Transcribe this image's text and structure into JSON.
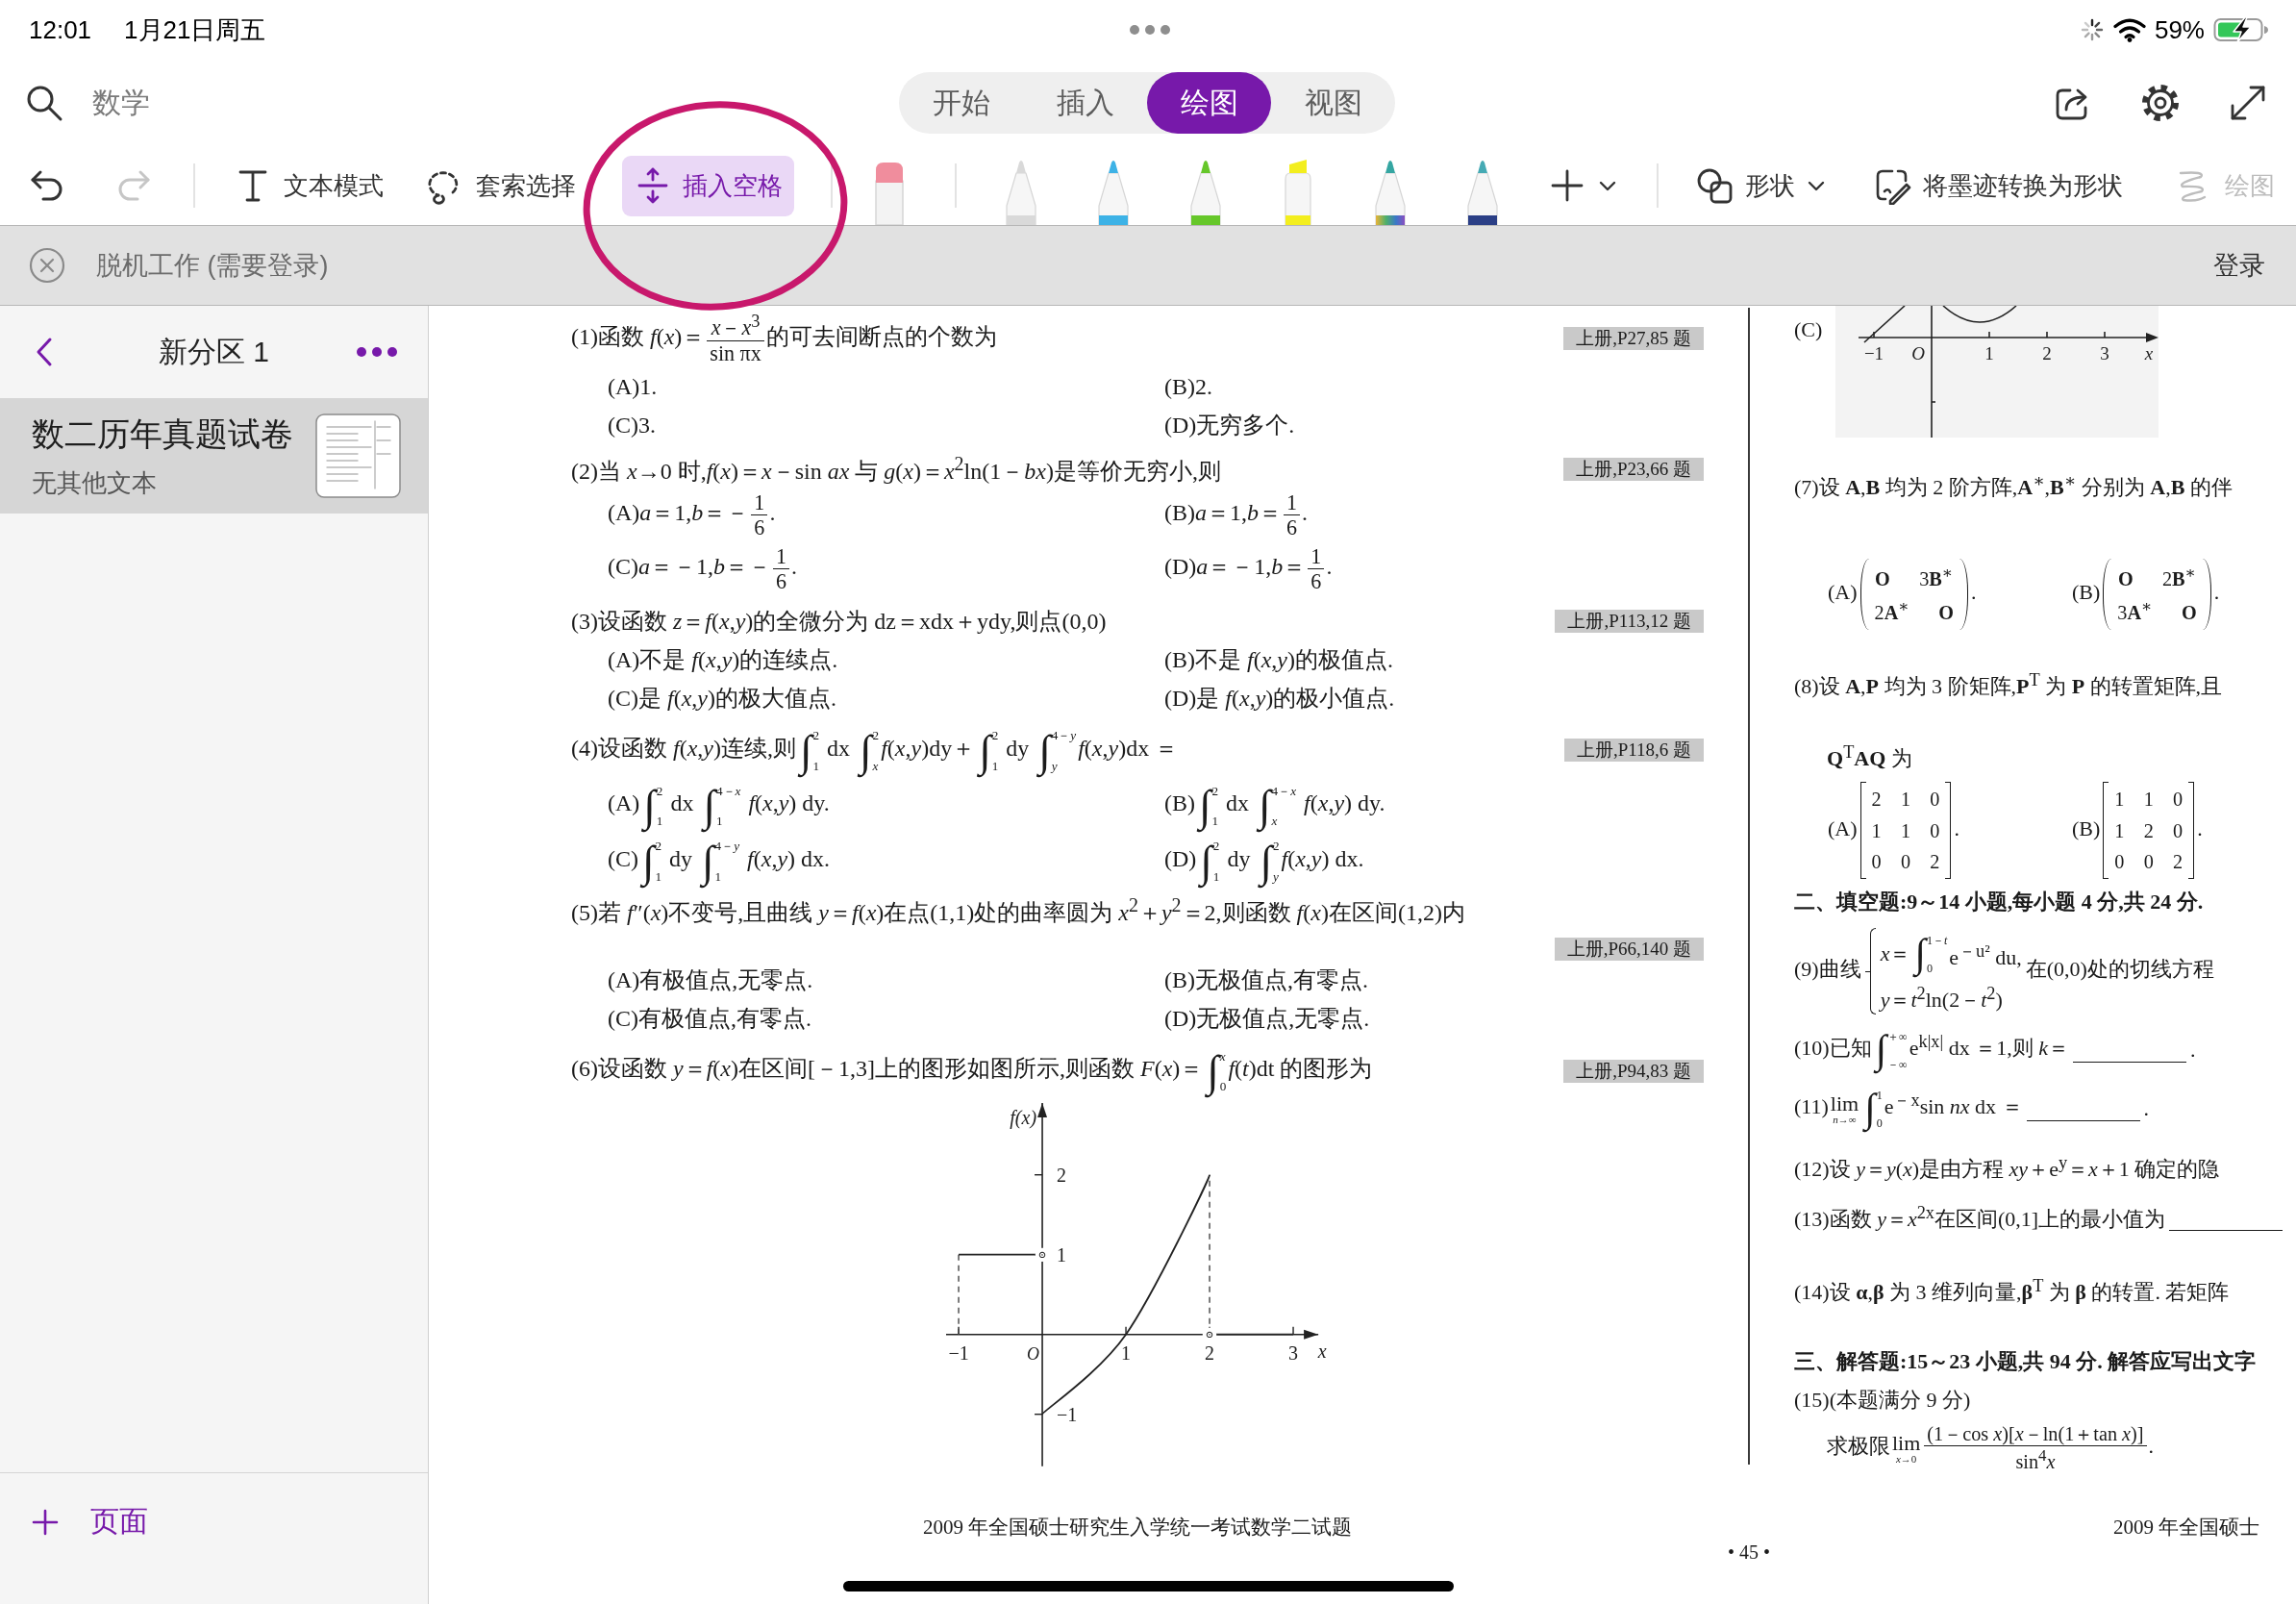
{
  "status_bar": {
    "time": "12:01",
    "date": "1月21日周五",
    "battery": "59%",
    "charging": true
  },
  "header": {
    "notebook": "数学",
    "tabs": [
      {
        "label": "开始",
        "selected": false
      },
      {
        "label": "插入",
        "selected": false
      },
      {
        "label": "绘图",
        "selected": true
      },
      {
        "label": "视图",
        "selected": false
      }
    ]
  },
  "toolbar": {
    "undo": {
      "disabled": false
    },
    "redo": {
      "disabled": true
    },
    "tools": [
      {
        "kind": "text",
        "label": "文本模式",
        "selected": false
      },
      {
        "kind": "lasso",
        "label": "套索选择",
        "selected": false
      },
      {
        "kind": "space",
        "label": "插入空格",
        "selected": true
      }
    ],
    "eraser": {
      "selected": false
    },
    "pens": [
      {
        "kind": "pen",
        "color": "#d9d9d9",
        "selected": false
      },
      {
        "kind": "pen",
        "color": "#3db2e6",
        "selected": false
      },
      {
        "kind": "pen",
        "color": "#66c72a",
        "selected": false
      },
      {
        "kind": "highlighter",
        "color": "#f3ee1e",
        "selected": false
      },
      {
        "kind": "rainbow",
        "color": "#35a6a2",
        "selected": false
      },
      {
        "kind": "cosmic",
        "color": "#45aab4",
        "selected": false
      }
    ],
    "shapes": {
      "label": "形状"
    },
    "ink_to_shape": {
      "label": "将墨迹转换为形状"
    },
    "ink_tool": {
      "label": "绘图"
    }
  },
  "notice": {
    "message": "脱机工作 (需要登录)",
    "action": "登录"
  },
  "sidebar": {
    "section": "新分区 1",
    "pages": [
      {
        "title": "数二历年真题试卷",
        "preview": "无其他文本",
        "selected": true
      }
    ],
    "add_page": "页面"
  },
  "document": {
    "left_column": {
      "questions": [
        {
          "lines": [
            [
              "(1)函数 *f*(*x*)＝",
              {
                "kind": "frac",
                "num": "*x*－*x*$^{3}$",
                "den": "sin πx"
              },
              "的可去间断点的个数为"
            ]
          ],
          "tag": "上册,P27,85 题",
          "options": [
            [
              "(A)1."
            ],
            [
              "(B)2."
            ],
            [
              "(C)3."
            ],
            [
              "(D)无穷多个."
            ]
          ]
        },
        {
          "lines": [
            [
              "(2)当 *x*→0 时,*f*(*x*)＝*x*－sin *ax* 与 *g*(*x*)＝*x*$^{2}$ln(1－*bx*)是等价无穷小,则"
            ]
          ],
          "tag": "上册,P23,66 题",
          "options": [
            [
              "(A)*a*＝1,*b*＝－",
              {
                "kind": "frac",
                "num": "1",
                "den": "6"
              },
              "."
            ],
            [
              "(B)*a*＝1,*b*＝",
              {
                "kind": "frac",
                "num": "1",
                "den": "6"
              },
              "."
            ],
            [
              "(C)*a*＝－1,*b*＝－",
              {
                "kind": "frac",
                "num": "1",
                "den": "6"
              },
              "."
            ],
            [
              "(D)*a*＝－1,*b*＝",
              {
                "kind": "frac",
                "num": "1",
                "den": "6"
              },
              "."
            ]
          ]
        },
        {
          "lines": [
            [
              "(3)设函数 *z*＝*f*(*x*,*y*)的全微分为 dz＝xdx＋ydy,则点(0,0)"
            ]
          ],
          "tag": "上册,P113,12 题",
          "options": [
            [
              "(A)不是 *f*(*x*,*y*)的连续点."
            ],
            [
              "(B)不是 *f*(*x*,*y*)的极值点."
            ],
            [
              "(C)是 *f*(*x*,*y*)的极大值点."
            ],
            [
              "(D)是 *f*(*x*,*y*)的极小值点."
            ]
          ]
        },
        {
          "lines": [
            [
              "(4)设函数 *f*(*x*,*y*)连续,则",
              {
                "kind": "int",
                "sign": "∫",
                "lower": "1",
                "upper": "2"
              },
              " dx ",
              {
                "kind": "int",
                "sign": "∫",
                "lower": "*x*",
                "upper": "2"
              },
              "*f*(*x*,*y*)dy＋",
              {
                "kind": "int",
                "sign": "∫",
                "lower": "1",
                "upper": "2"
              },
              " dy ",
              {
                "kind": "int",
                "sign": "∫",
                "lower": "*y*",
                "upper": "4－*y*"
              },
              "*f*(*x*,*y*)dx ＝"
            ]
          ],
          "tag": "上册,P118,6 题",
          "options": [
            [
              "(A)",
              {
                "kind": "int",
                "sign": "∫",
                "lower": "1",
                "upper": "2"
              },
              " dx ",
              {
                "kind": "int",
                "sign": "∫",
                "lower": "1",
                "upper": "4－*x*"
              },
              " *f*(*x*,*y*) dy."
            ],
            [
              "(B)",
              {
                "kind": "int",
                "sign": "∫",
                "lower": "1",
                "upper": "2"
              },
              " dx ",
              {
                "kind": "int",
                "sign": "∫",
                "lower": "*x*",
                "upper": "4－*x*"
              },
              " *f*(*x*,*y*) dy."
            ],
            [
              "(C)",
              {
                "kind": "int",
                "sign": "∫",
                "lower": "1",
                "upper": "2"
              },
              " dy ",
              {
                "kind": "int",
                "sign": "∫",
                "lower": "1",
                "upper": "4－*y*"
              },
              " *f*(*x*,*y*) dx."
            ],
            [
              "(D)",
              {
                "kind": "int",
                "sign": "∫",
                "lower": "1",
                "upper": "2"
              },
              " dy ",
              {
                "kind": "int",
                "sign": "∫",
                "lower": "*y*",
                "upper": "2"
              },
              "*f*(*x*,*y*) dx."
            ]
          ]
        },
        {
          "lines": [
            [
              "(5)若 *f*″(*x*)不变号,且曲线 *y*＝*f*(*x*)在点(1,1)处的曲率圆为 *x*$^{2}$＋*y*$^{2}$＝2,则函数 *f*(*x*)在区间(1,2)内"
            ]
          ],
          "tag": "上册,P66,140 题",
          "options": [
            [
              "(A)有极值点,无零点."
            ],
            [
              "(B)无极值点,有零点."
            ],
            [
              "(C)有极值点,有零点."
            ],
            [
              "(D)无极值点,无零点."
            ]
          ]
        },
        {
          "lines": [
            [
              "(6)设函数 *y*＝*f*(*x*)在区间[－1,3]上的图形如图所示,则函数 *F*(*x*)＝",
              {
                "kind": "int",
                "sign": "∫",
                "lower": "0",
                "upper": "*x*"
              },
              "*f*(*t*)dt 的图形为"
            ]
          ],
          "tag": "上册,P94,83 题",
          "chart_data": {
            "type": "line",
            "xlabel": "x",
            "ylabel": "f(x)",
            "x": [
              -1,
              0,
              1,
              2,
              3
            ],
            "series": [
              {
                "values": [
                  1,
                  1,
                  null,
                  null,
                  null
                ]
              },
              {
                "values": [
                  null,
                  -1,
                  0,
                  2,
                  null
                ]
              },
              {
                "values": [
                  null,
                  null,
                  null,
                  0,
                  0
                ]
              }
            ],
            "xlim": [
              -1.15,
              3.3
            ],
            "ylim": [
              -1.65,
              2.9
            ],
            "xticks": [
              {
                "value": -1,
                "label": "−1"
              },
              {
                "value": 0,
                "label": "O"
              },
              {
                "value": 1,
                "label": "1"
              },
              {
                "value": 2,
                "label": "2"
              },
              {
                "value": 3,
                "label": "3"
              }
            ],
            "yticks": [
              {
                "value": -1,
                "label": "−1"
              },
              {
                "value": 1,
                "label": "1"
              },
              {
                "value": 2,
                "label": "2"
              }
            ],
            "ref_lines": [
              {
                "axis": "x",
                "value": -1
              },
              {
                "axis": "x",
                "value": 2
              }
            ],
            "annotations": [
              {
                "x": 0,
                "y": 1,
                "text": "◦"
              },
              {
                "x": 2,
                "y": 0,
                "text": "◦"
              }
            ]
          }
        }
      ],
      "footer": "2009 年全国硕士研究生入学统一考试数学二试题"
    },
    "page_number": "• 45 •",
    "right_column": {
      "blocks": [
        {
          "kind": "figure",
          "label": "(C)",
          "tick_labels": [
            "−1",
            "O",
            "1",
            "2",
            "3",
            "x"
          ]
        },
        {
          "kind": "question",
          "lines": [
            [
              "(7)设 **A**,**B** 均为 2 阶方阵,**A**$^{∗}$,**B**$^{∗}$ 分别为 **A**,**B** 的伴"
            ]
          ],
          "options": [
            [
              "(A)",
              {
                "kind": "pmatrix",
                "lines": [
                  "**O**      3**B**$^{∗}$",
                  "2**A**$^{∗}$      **O**"
                ]
              },
              "."
            ],
            [
              "(B)",
              {
                "kind": "pmatrix",
                "lines": [
                  "**O**      2**B**$^{∗}$",
                  "3**A**$^{∗}$      **O**"
                ]
              },
              "."
            ]
          ]
        },
        {
          "kind": "question",
          "lines": [
            [
              "(8)设 **A**,**P** 均为 3 阶矩阵,**P**$^{T}$ 为 **P** 的转置矩阵,且"
            ],
            [
              "**Q**$^{T}$**AQ** 为"
            ]
          ],
          "options": [
            [
              "(A)",
              {
                "kind": "bmatrix",
                "lines": [
                  "2    1    0",
                  "1    1    0",
                  "0    0    2"
                ]
              },
              "."
            ],
            [
              "(B)",
              {
                "kind": "bmatrix",
                "lines": [
                  "1    1    0",
                  "1    2    0",
                  "0    0    2"
                ]
              },
              "."
            ]
          ]
        },
        {
          "kind": "heading",
          "text": "二、填空题:9～14 小题,每小题 4 分,共 24 分."
        },
        {
          "kind": "question",
          "lines": [
            [
              "(9)曲线",
              {
                "kind": "cases",
                "rows": [
                  [
                    "*x*＝",
                    {
                      "kind": "int",
                      "sign": "∫",
                      "lower": "0",
                      "upper": "1－*t*"
                    },
                    "e$^{－u²}$ du,"
                  ],
                  [
                    "*y*＝*t*$^{2}$ln(2－*t*$^{2}$)"
                  ]
                ]
              },
              "在(0,0)处的切线方程"
            ]
          ]
        },
        {
          "kind": "question",
          "lines": [
            [
              "(10)已知",
              {
                "kind": "int",
                "sign": "∫",
                "lower": "－∞",
                "upper": "＋∞"
              },
              "e$^{k|x|}$ dx ＝1,则 *k*＝",
              {
                "kind": "blank"
              },
              "."
            ]
          ]
        },
        {
          "kind": "question",
          "lines": [
            [
              "(11)",
              {
                "kind": "lim",
                "op": "lim",
                "sub": "*n*→∞"
              },
              {
                "kind": "int",
                "sign": "∫",
                "lower": "0",
                "upper": "1"
              },
              "e$^{－x}$sin *nx* dx ＝",
              {
                "kind": "blank"
              },
              "."
            ]
          ]
        },
        {
          "kind": "question",
          "lines": [
            [
              "(12)设 *y*＝*y*(*x*)是由方程 *xy*＋e$^{y}$＝*x*＋1 确定的隐"
            ]
          ]
        },
        {
          "kind": "question",
          "lines": [
            [
              "(13)函数 *y*＝*x*$^{2x}$在区间(0,1]上的最小值为",
              {
                "kind": "blank"
              }
            ]
          ]
        },
        {
          "kind": "question",
          "lines": [
            [
              "(14)设 **α**,**β** 为 3 维列向量,**β**$^{T}$ 为 **β** 的转置. 若矩阵"
            ]
          ]
        },
        {
          "kind": "heading",
          "text": "三、解答题:15～23 小题,共 94 分. 解答应写出文字"
        },
        {
          "kind": "question",
          "lines": [
            [
              "(15)(本题满分 9 分)"
            ],
            [
              "求极限",
              {
                "kind": "lim",
                "op": "lim",
                "sub": "*x*→0"
              },
              {
                "kind": "frac",
                "num": "(1－cos *x*)[*x*－ln(1＋tan *x*)]",
                "den": "sin$^{4}$*x*"
              },
              "."
            ]
          ]
        }
      ],
      "footer": "2009 年全国硕士"
    }
  },
  "ink": [
    {
      "kind": "ellipse"
    }
  ]
}
